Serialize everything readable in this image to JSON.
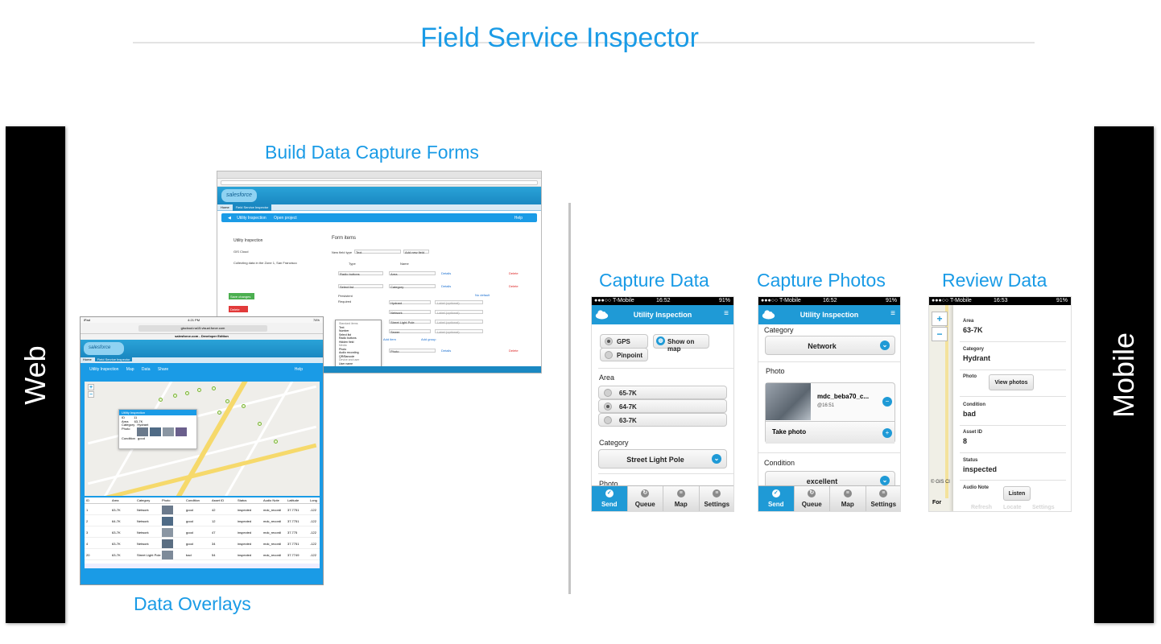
{
  "title": "Field Service Inspector",
  "side_labels": {
    "left": "Web",
    "right": "Mobile"
  },
  "captions": {
    "build": "Build Data Capture Forms",
    "overlays": "Data Overlays",
    "capture_data": "Capture Data",
    "capture_photos": "Capture Photos",
    "review_data": "Review Data"
  },
  "build_form": {
    "tabs": [
      "Home",
      "Field Service Inspector"
    ],
    "logo": "salesforce",
    "app_title": "Utility Inspection",
    "app_link": "Open project",
    "help": "Help",
    "tree": [
      "Utility Inspection",
      "GIS Cloud",
      "Collecting data in the Zone 1, San Francisco"
    ],
    "form_items_heading": "Form items",
    "new_field_type_label": "New field type",
    "new_field_type_value": "Text",
    "add_new_field": "Add new field",
    "col_type": "Type",
    "col_name": "Name",
    "rows": [
      {
        "type": "Radio buttons",
        "name": "Area"
      },
      {
        "type": "Select list",
        "name": "Category"
      }
    ],
    "options": [
      "Hydrant",
      "Network",
      "Street Light Pole",
      "Sewer"
    ],
    "label_placeholder": "Label (optional)",
    "photo_name": "Photo",
    "details": "Details",
    "delete": "Delete",
    "no_default": "No default",
    "add_item": "Add item",
    "add_group": "Add group",
    "save_changes": "Save changes",
    "delete_project": "Delete project",
    "persistent": "Persistent",
    "required": "Required",
    "dropdown": [
      "Standard items",
      "Text",
      "Number",
      "Select list",
      "Radio buttons",
      "Hidden field",
      "Media",
      "Photo",
      "Audio recording",
      "QR/Barcode",
      "Device and user",
      "User name"
    ]
  },
  "overlays": {
    "time": "4:21 PM",
    "device": "iPad",
    "battery": "74%",
    "url": "giscloud.na15.visual.force.com",
    "page_title": "salesforce.com - Developer Edition",
    "tabs": [
      "Home",
      "Field Service Inspector"
    ],
    "app_title": "Utility Inspection",
    "app_tabs": [
      "Map",
      "Data",
      "Share"
    ],
    "help": "Help",
    "popup_title": "Utility Inspection",
    "popup_fields": [
      {
        "k": "ID",
        "v": "11"
      },
      {
        "k": "Area",
        "v": "63-7K"
      },
      {
        "k": "Category",
        "v": "Hydrant"
      },
      {
        "k": "Photo",
        "v": ""
      },
      {
        "k": "Condition",
        "v": "good"
      }
    ],
    "table_headers": [
      "ID",
      "Area",
      "Category",
      "Photo",
      "Condition",
      "Asset ID",
      "Status",
      "Audio Note",
      "Latitude",
      "Long"
    ],
    "table_rows": [
      [
        "1",
        "63-7K",
        "Network",
        "",
        "good",
        "42",
        "inspected",
        "mdc_recordi",
        "37.7751",
        "-122"
      ],
      [
        "2",
        "64-7K",
        "Network",
        "",
        "good",
        "12",
        "inspected",
        "mdc_recordi",
        "37.7751",
        "-122"
      ],
      [
        "3",
        "63-7K",
        "Network",
        "",
        "good",
        "47",
        "inspected",
        "mdc_recordi",
        "37.775",
        "-122"
      ],
      [
        "4",
        "63-7K",
        "Network",
        "",
        "good",
        "34",
        "inspected",
        "mdc_recordi",
        "37.7751",
        "-122"
      ],
      [
        "20",
        "63-7K",
        "Street Light Pole",
        "",
        "bad",
        "54",
        "inspected",
        "mdc_recordi",
        "37.7749",
        "-122"
      ]
    ]
  },
  "capture_data": {
    "carrier": "●●●○○ T-Mobile",
    "time": "16:52",
    "battery": "91%",
    "header": "Utility Inspection",
    "location_options": [
      "GPS",
      "Pinpoint"
    ],
    "show_on_map": "Show on map",
    "area_label": "Area",
    "area_options": [
      "65-7K",
      "64-7K",
      "63-7K"
    ],
    "category_label": "Category",
    "category_value": "Street Light Pole",
    "photo_label": "Photo"
  },
  "capture_photos": {
    "carrier": "●●●○○ T-Mobile",
    "time": "16:52",
    "battery": "91%",
    "header": "Utility Inspection",
    "category_label": "Category",
    "category_value": "Network",
    "photo_label": "Photo",
    "photo_name": "mdc_beba70_c...",
    "photo_time": "@16:51",
    "take_photo": "Take photo",
    "condition_label": "Condition",
    "condition_value": "excellent"
  },
  "navbar": [
    "Send",
    "Queue",
    "Map",
    "Settings"
  ],
  "review_data": {
    "carrier": "●●●○○ T-Mobile",
    "time": "16:53",
    "battery": "91%",
    "fields": [
      {
        "k": "Area",
        "v": "63-7K"
      },
      {
        "k": "Category",
        "v": "Hydrant"
      },
      {
        "k": "Condition",
        "v": "bad"
      },
      {
        "k": "Asset ID",
        "v": "8"
      },
      {
        "k": "Status",
        "v": "inspected"
      }
    ],
    "photo_label": "Photo",
    "view_photos": "View photos",
    "audio_label": "Audio Note",
    "listen": "Listen",
    "copyright": "© GIS Cl",
    "faded_nav": [
      "Refresh",
      "Locate",
      "Settings"
    ],
    "partial_nav": "For"
  },
  "colors": {
    "accent": "#1a9be6",
    "bar": "#000000",
    "header": "#1f9ad6"
  },
  "icons": [
    "cloud-icon",
    "menu-icon",
    "gps-icon",
    "globe-icon",
    "chevron-down-icon",
    "plus-icon",
    "minus-icon",
    "check-icon",
    "queue-icon",
    "map-icon",
    "settings-icon"
  ]
}
